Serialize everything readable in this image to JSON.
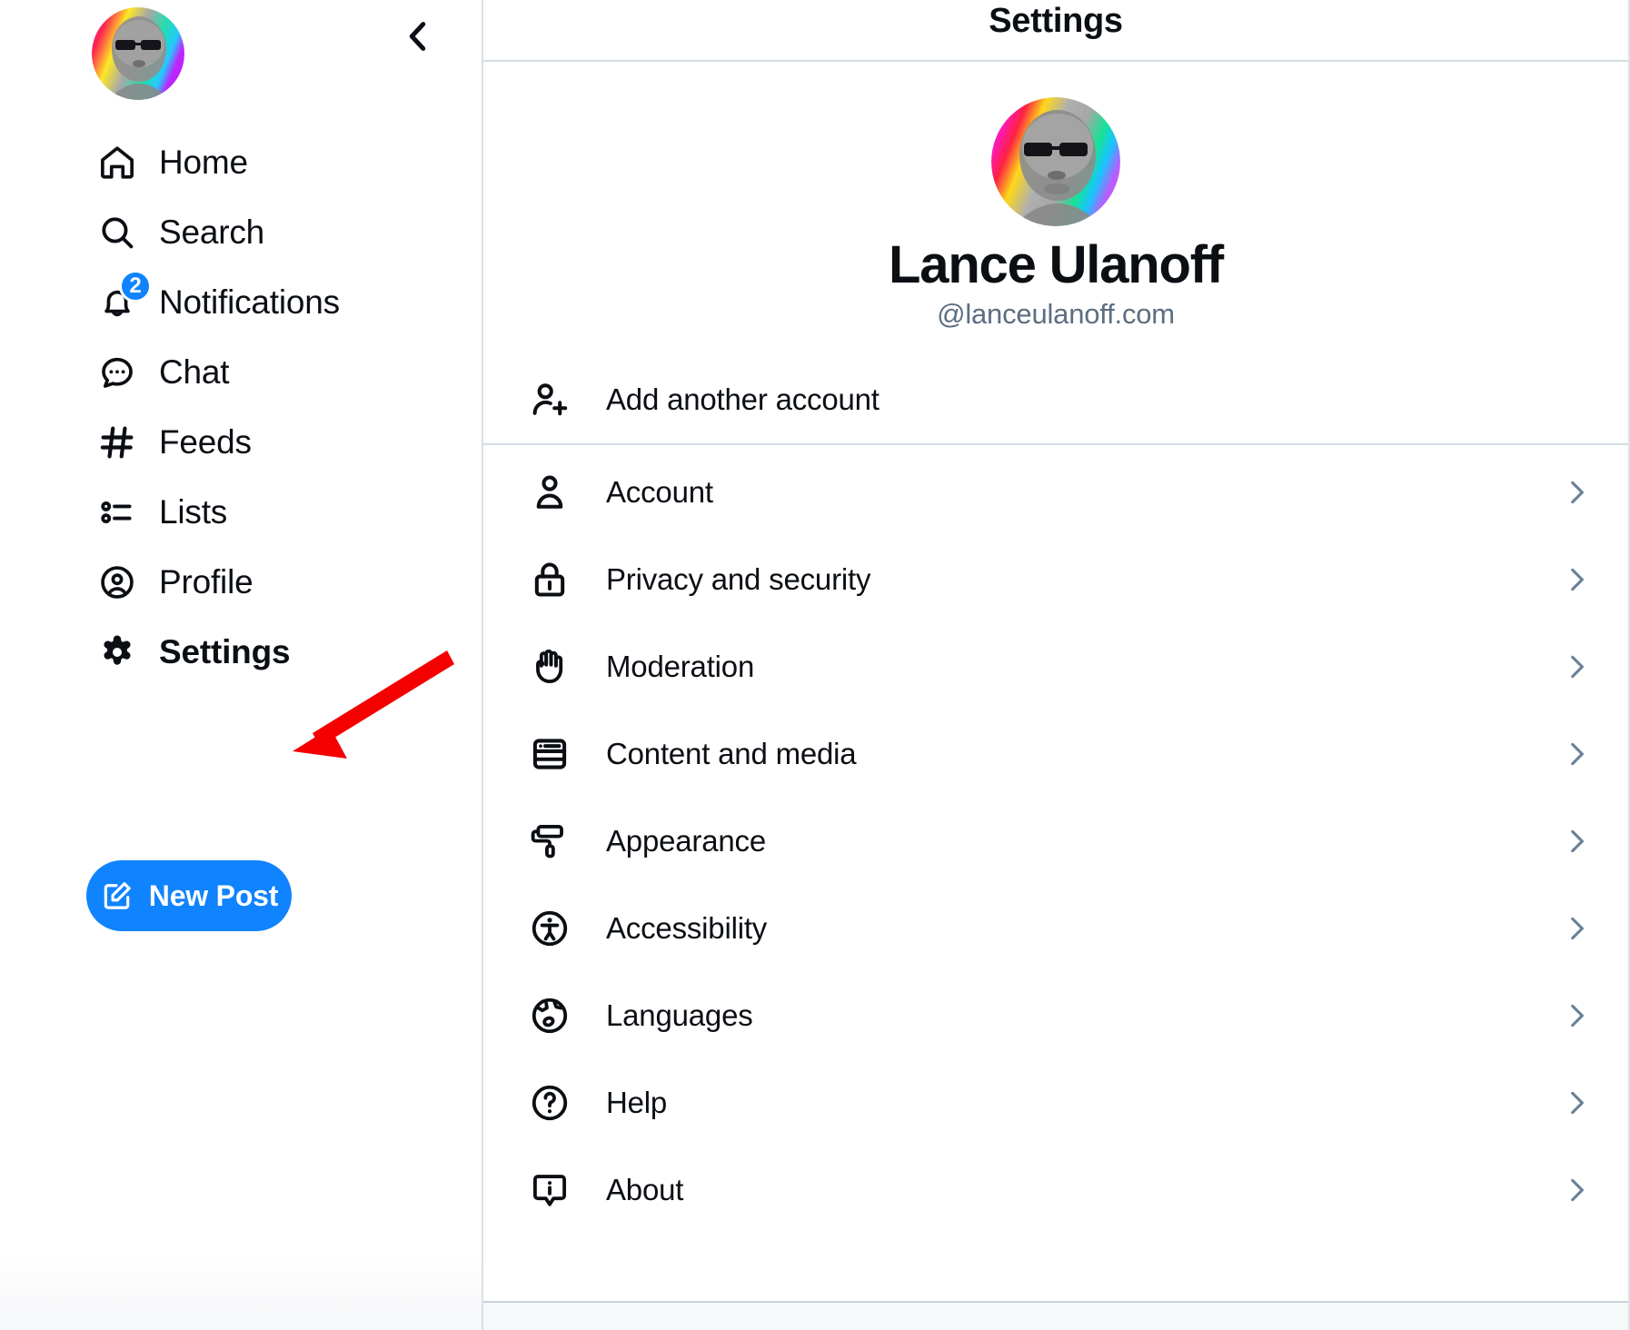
{
  "sidebar": {
    "avatar_name": "user-avatar",
    "collapse_icon": "chevron-left-icon",
    "items": [
      {
        "label": "Home",
        "icon": "home-icon",
        "active": false,
        "badge": null
      },
      {
        "label": "Search",
        "icon": "search-icon",
        "active": false,
        "badge": null
      },
      {
        "label": "Notifications",
        "icon": "bell-icon",
        "active": false,
        "badge": "2"
      },
      {
        "label": "Chat",
        "icon": "chat-bubble-icon",
        "active": false,
        "badge": null
      },
      {
        "label": "Feeds",
        "icon": "hashtag-icon",
        "active": false,
        "badge": null
      },
      {
        "label": "Lists",
        "icon": "list-icon",
        "active": false,
        "badge": null
      },
      {
        "label": "Profile",
        "icon": "user-circle-icon",
        "active": false,
        "badge": null
      },
      {
        "label": "Settings",
        "icon": "gear-icon",
        "active": true,
        "badge": null
      }
    ],
    "new_post": {
      "label": "New Post",
      "icon": "compose-icon",
      "color": "#1083fe"
    }
  },
  "panel": {
    "title": "Settings",
    "profile": {
      "display_name": "Lance Ulanoff",
      "handle": "@lanceulanoff.com",
      "avatar_name": "profile-avatar"
    },
    "add_account": {
      "label": "Add another account",
      "icon": "user-plus-icon"
    },
    "settings_items": [
      {
        "label": "Account",
        "icon": "person-icon"
      },
      {
        "label": "Privacy and security",
        "icon": "lock-icon"
      },
      {
        "label": "Moderation",
        "icon": "hand-icon"
      },
      {
        "label": "Content and media",
        "icon": "window-icon"
      },
      {
        "label": "Appearance",
        "icon": "paint-roller-icon"
      },
      {
        "label": "Accessibility",
        "icon": "accessibility-icon"
      },
      {
        "label": "Languages",
        "icon": "globe-icon"
      },
      {
        "label": "Help",
        "icon": "question-circle-icon"
      },
      {
        "label": "About",
        "icon": "info-bubble-icon"
      }
    ],
    "chevron_icon": "chevron-right-icon",
    "chevron_color": "#6b8199"
  },
  "annotation": {
    "arrow_color": "#f40000",
    "arrow_name": "red-pointer-arrow",
    "points_to": "Settings"
  },
  "theme": {
    "accent": "#1083fe",
    "text": "#0b0f14",
    "muted": "#5c6e82",
    "border": "#d4dbe2",
    "background": "#ffffff"
  }
}
